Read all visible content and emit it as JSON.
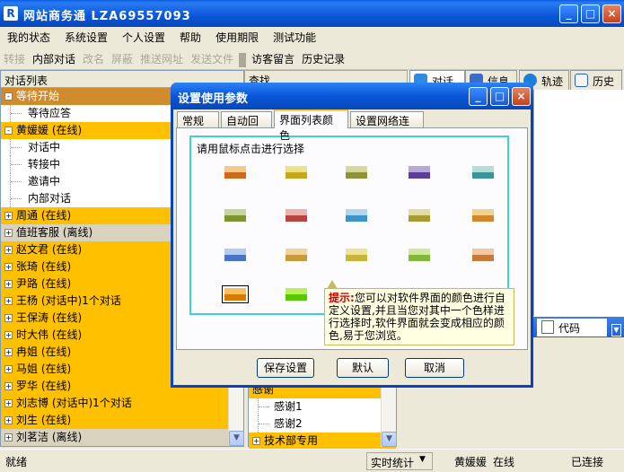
{
  "app": {
    "title": "网站商务通  LZA69557093"
  },
  "menu": [
    "我的状态",
    "系统设置",
    "个人设置",
    "帮助",
    "使用期限",
    "测试功能"
  ],
  "toolbar": {
    "items": [
      {
        "label": "转接",
        "enabled": false
      },
      {
        "label": "内部对话",
        "enabled": true
      },
      {
        "label": "改名",
        "enabled": false
      },
      {
        "label": "屏蔽",
        "enabled": false
      },
      {
        "label": "推送网址",
        "enabled": false
      },
      {
        "label": "发送文件",
        "enabled": false
      },
      {
        "label": "访客留言",
        "enabled": true
      },
      {
        "label": "历史记录",
        "enabled": true
      }
    ]
  },
  "left_panel": {
    "header": "对话列表",
    "rows": [
      {
        "text": "等待开始",
        "kind": "head",
        "sign": "-"
      },
      {
        "text": "等待应答",
        "kind": "child"
      },
      {
        "text": "黄媛媛 (在线)",
        "kind": "grp",
        "sign": "-"
      },
      {
        "text": "对话中",
        "kind": "child"
      },
      {
        "text": "转接中",
        "kind": "child"
      },
      {
        "text": "邀请中",
        "kind": "child"
      },
      {
        "text": "内部对话",
        "kind": "child"
      },
      {
        "text": "周通 (在线)",
        "kind": "grp",
        "sign": "+"
      },
      {
        "text": "值班客服 (离线)",
        "kind": "gray",
        "sign": "+"
      },
      {
        "text": "赵文君 (在线)",
        "kind": "grp",
        "sign": "+"
      },
      {
        "text": "张琦 (在线)",
        "kind": "grp",
        "sign": "+"
      },
      {
        "text": "尹路 (在线)",
        "kind": "grp",
        "sign": "+"
      },
      {
        "text": "王杨 (对话中)1个对话",
        "kind": "grp",
        "sign": "+"
      },
      {
        "text": "王保涛 (在线)",
        "kind": "grp",
        "sign": "+"
      },
      {
        "text": "时大伟 (在线)",
        "kind": "grp",
        "sign": "+"
      },
      {
        "text": "冉姐 (在线)",
        "kind": "grp",
        "sign": "+"
      },
      {
        "text": "马姐 (在线)",
        "kind": "grp",
        "sign": "+"
      },
      {
        "text": "罗华 (在线)",
        "kind": "grp",
        "sign": "+"
      },
      {
        "text": "刘志博 (对话中)1个对话",
        "kind": "grp",
        "sign": "+"
      },
      {
        "text": "刘生 (在线)",
        "kind": "grp",
        "sign": "+"
      },
      {
        "text": "刘茗洁 (离线)",
        "kind": "gray",
        "sign": "+"
      }
    ]
  },
  "search": {
    "label": "查找"
  },
  "right_tabs": [
    {
      "label": "对话",
      "icon": "chat-icon"
    },
    {
      "label": "信息",
      "icon": "info-icon"
    },
    {
      "label": "轨迹",
      "icon": "track-icon"
    },
    {
      "label": "历史",
      "icon": "history-icon"
    }
  ],
  "code_bar": {
    "label": "代码"
  },
  "mid_list": {
    "rows": [
      {
        "text": "感谢",
        "kind": "grp"
      },
      {
        "text": "感谢1",
        "kind": "child"
      },
      {
        "text": "感谢2",
        "kind": "child"
      },
      {
        "text": "技术部专用",
        "kind": "grp",
        "sign": "+"
      }
    ]
  },
  "status_bar": {
    "left": "就绪",
    "stats": "实时统计",
    "user": "黄媛媛",
    "state": "在线",
    "connection": "已连接"
  },
  "dialog": {
    "title": "设置使用参数",
    "tabs": [
      "常规",
      "自动回复",
      "界面列表颜色",
      "设置网络连接"
    ],
    "active_tab": 2,
    "hint": "请用鼠标点击进行选择",
    "colors": [
      {
        "top": "#f5c98a",
        "bottom": "#cc6a1a"
      },
      {
        "top": "#ece28a",
        "bottom": "#c2a81a"
      },
      {
        "top": "#d6d89e",
        "bottom": "#8e9238"
      },
      {
        "top": "#b6a8d8",
        "bottom": "#5a3e9a"
      },
      {
        "top": "#b8dcd8",
        "bottom": "#3a9498"
      },
      {
        "top": "#c8d49e",
        "bottom": "#7e9432"
      },
      {
        "top": "#e8b4b0",
        "bottom": "#b84440"
      },
      {
        "top": "#b0d8ec",
        "bottom": "#3a94c8"
      },
      {
        "top": "#e2dca0",
        "bottom": "#a89a32"
      },
      {
        "top": "#f2d08e",
        "bottom": "#d0862a"
      },
      {
        "top": "#b4ccf2",
        "bottom": "#4a74c8"
      },
      {
        "top": "#f0d49a",
        "bottom": "#c89a3a"
      },
      {
        "top": "#ece49a",
        "bottom": "#c8b43a"
      },
      {
        "top": "#d0e8a0",
        "bottom": "#82b83a"
      },
      {
        "top": "#f2c8a0",
        "bottom": "#c47a3a"
      },
      {
        "top": "#f8c060",
        "bottom": "#d87a00"
      },
      {
        "top": "#b8f060",
        "bottom": "#58c800"
      },
      {
        "top": "#f06050",
        "bottom": "#c81c10"
      },
      {
        "top": "#f8f060",
        "bottom": "#d8c800"
      },
      {
        "top": "#f060e8",
        "bottom": "#c010c0"
      }
    ],
    "selected_color": 15,
    "tip_label": "提示:",
    "tip_text": "您可以对软件界面的颜色进行自定义设置,并且当您对其中一个色样进行选择时,软件界面就会变成相应的颜色,易于您浏览。",
    "buttons": {
      "save": "保存设置",
      "default": "默认",
      "cancel": "取消"
    }
  }
}
